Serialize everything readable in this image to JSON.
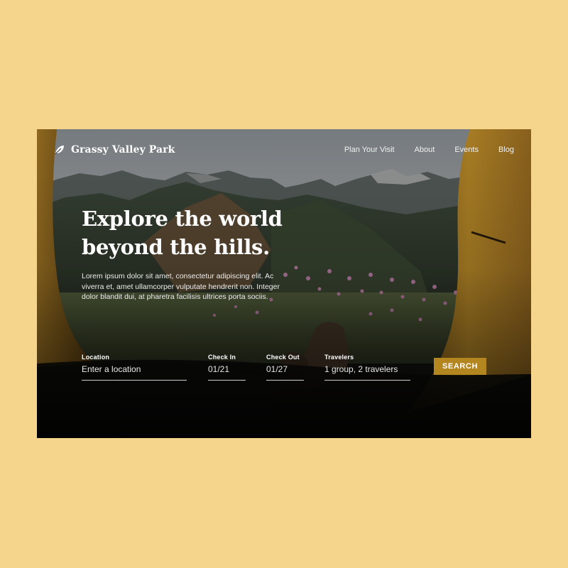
{
  "brand": {
    "name": "Grassy Valley Park",
    "logo_icon": "leaf-icon"
  },
  "nav": {
    "items": [
      "Plan Your Visit",
      "About",
      "Events",
      "Blog"
    ]
  },
  "hero": {
    "headline_line1": "Explore the world",
    "headline_line2": "beyond the hills.",
    "body": "Lorem ipsum dolor sit amet, consectetur adipiscing elit. Ac viverra et, amet ullamcorper vulputate hendrerit non. Integer dolor blandit dui, at pharetra facilisis ultrices porta sociis."
  },
  "search": {
    "location": {
      "label": "Location",
      "placeholder": "Enter a location"
    },
    "check_in": {
      "label": "Check In",
      "value": "01/21"
    },
    "check_out": {
      "label": "Check Out",
      "value": "01/27"
    },
    "travelers": {
      "label": "Travelers",
      "value": "1 group, 2 travelers"
    },
    "button_label": "SEARCH"
  },
  "colors": {
    "page_background": "#f5d58c",
    "accent": "#b3861f",
    "tent_fabric": "#c4922a",
    "text": "#ffffff"
  }
}
